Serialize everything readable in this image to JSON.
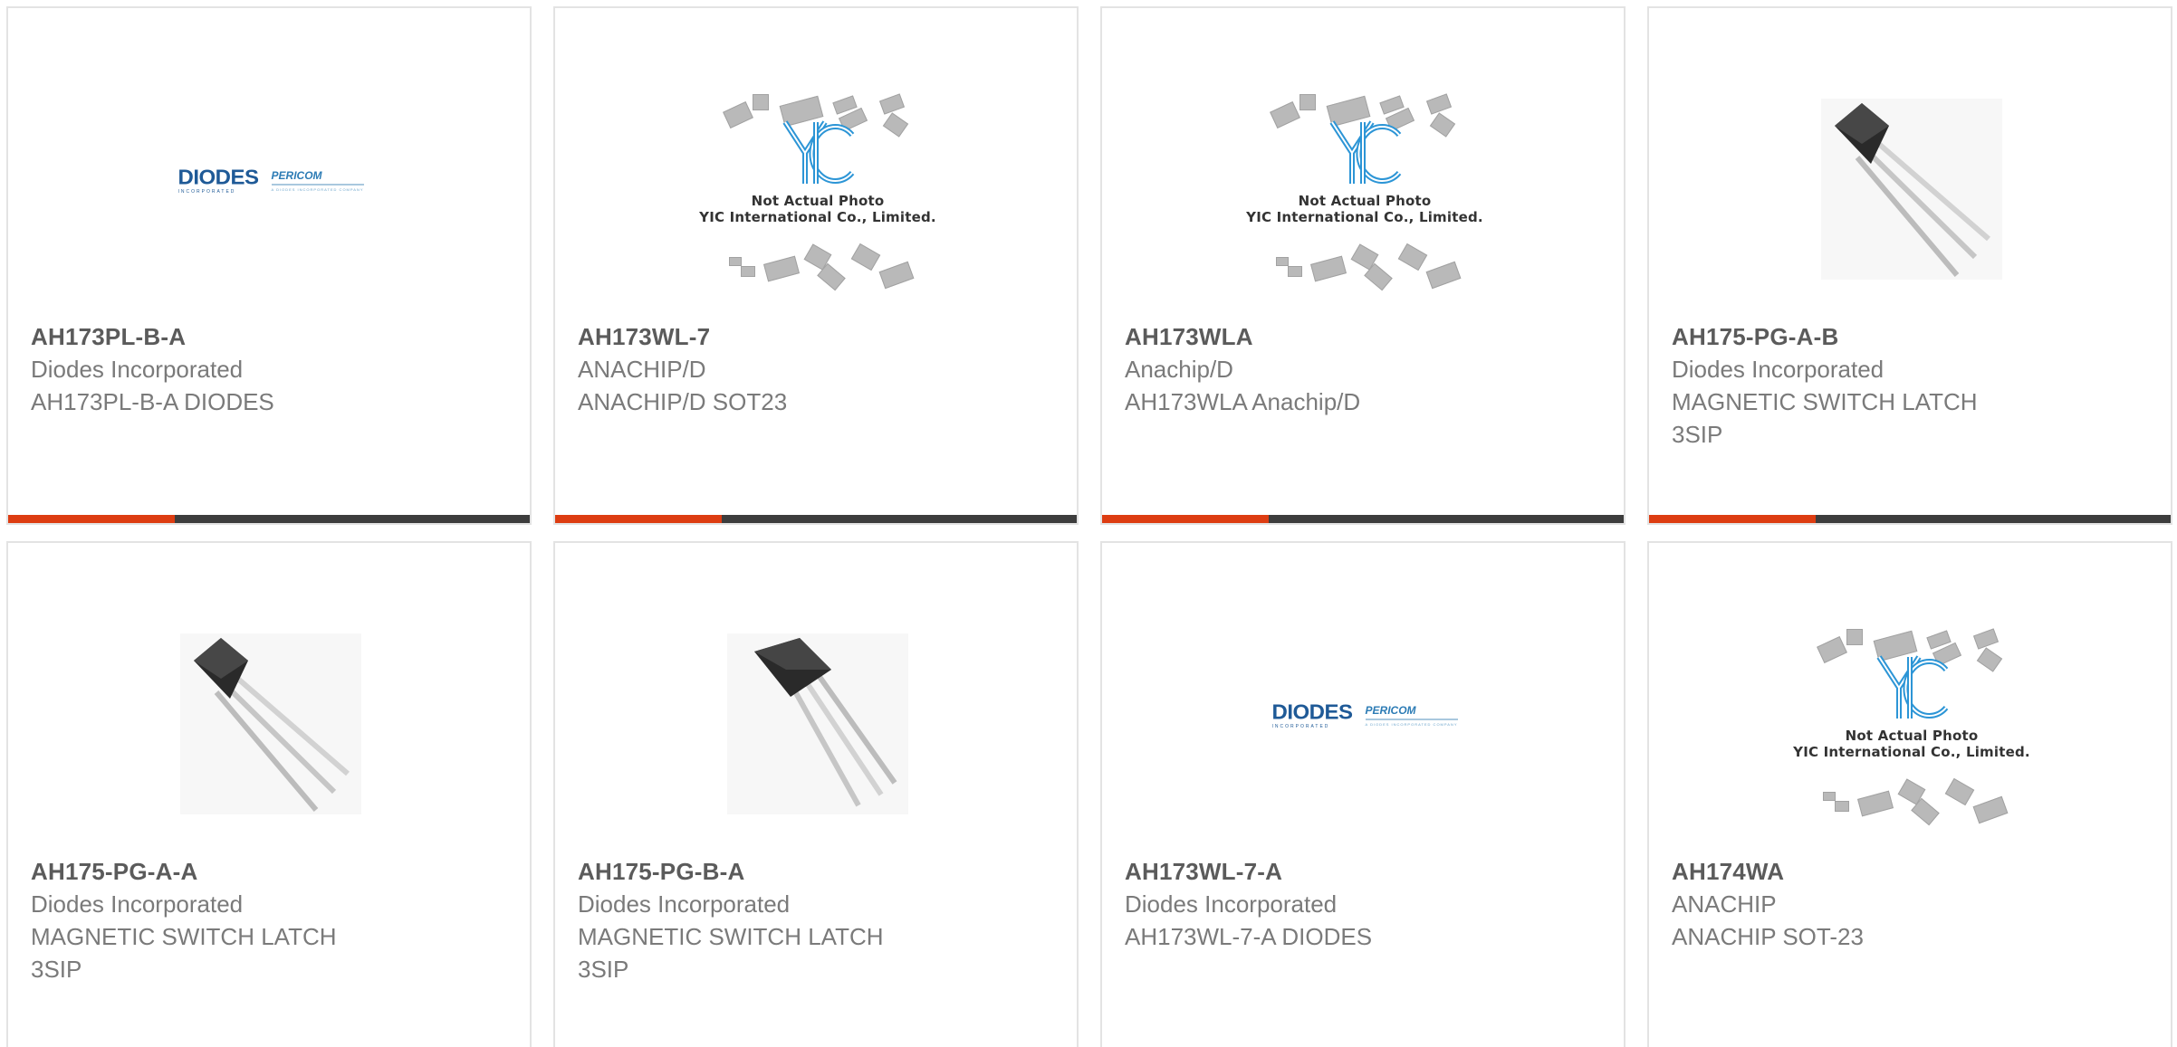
{
  "colors": {
    "accent": "#dd3d12",
    "bar": "#3d3d3d",
    "part_number": "#5b5b5b",
    "text": "#7a7a7a"
  },
  "placeholder": {
    "line1": "Not Actual Photo",
    "line2": "YIC International Co., Limited."
  },
  "logo": {
    "brand": "DIODES",
    "brand_sub": "INCORPORATED",
    "partner": "PERICOM",
    "partner_sub": "A DIODES INCORPORATED COMPANY"
  },
  "products": [
    {
      "part_number": "AH173PL-B-A",
      "manufacturer": "Diodes Incorporated",
      "description": "AH173PL-B-A DIODES",
      "image": "diodes-logo"
    },
    {
      "part_number": "AH173WL-7",
      "manufacturer": "ANACHIP/D",
      "description": "ANACHIP/D SOT23",
      "image": "yic-placeholder"
    },
    {
      "part_number": "AH173WLA",
      "manufacturer": "Anachip/D",
      "description": "AH173WLA Anachip/D",
      "image": "yic-placeholder"
    },
    {
      "part_number": "AH175-PG-A-B",
      "manufacturer": "Diodes Incorporated",
      "description": "MAGNETIC SWITCH LATCH 3SIP",
      "image": "to92-photo"
    },
    {
      "part_number": "AH175-PG-A-A",
      "manufacturer": "Diodes Incorporated",
      "description": "MAGNETIC SWITCH LATCH 3SIP",
      "image": "to92-photo"
    },
    {
      "part_number": "AH175-PG-B-A",
      "manufacturer": "Diodes Incorporated",
      "description": "MAGNETIC SWITCH LATCH 3SIP",
      "image": "to92-photo-alt"
    },
    {
      "part_number": "AH173WL-7-A",
      "manufacturer": "Diodes Incorporated",
      "description": "AH173WL-7-A DIODES",
      "image": "diodes-logo"
    },
    {
      "part_number": "AH174WA",
      "manufacturer": "ANACHIP",
      "description": "ANACHIP SOT-23",
      "image": "yic-placeholder"
    }
  ]
}
